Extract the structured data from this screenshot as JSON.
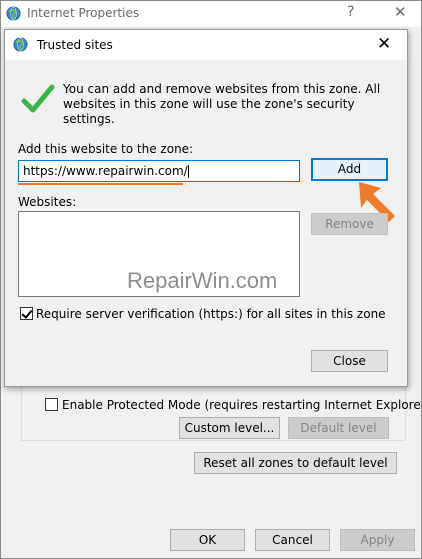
{
  "outer_window": {
    "title": "Internet Properties",
    "help_glyph": "?",
    "close_glyph": "✕",
    "enable_protected_mode_label": "Enable Protected Mode (requires restarting Internet Explorer)",
    "enable_protected_mode_checked": false,
    "custom_level_label": "Custom level...",
    "default_level_label": "Default level",
    "reset_all_label": "Reset all zones to default level",
    "ok_label": "OK",
    "cancel_label": "Cancel",
    "apply_label": "Apply"
  },
  "dialog": {
    "title": "Trusted sites",
    "close_glyph": "✕",
    "info_text": "You can add and remove websites from this zone. All websites in this zone will use the zone's security settings.",
    "add_label": "Add this website to the zone:",
    "url_value": "https://www.repairwin.com/",
    "add_button_label": "Add",
    "websites_label": "Websites:",
    "remove_button_label": "Remove",
    "require_https_label": "Require server verification (https:) for all sites in this zone",
    "require_https_checked": true,
    "close_button_label": "Close"
  },
  "watermark": "RepairWin.com",
  "colors": {
    "accent": "#0078d7",
    "annotation": "#f07c28",
    "success": "#3bb54a"
  },
  "icons": [
    "globe-icon",
    "checkmark-icon",
    "close-icon",
    "arrow-annotation-icon"
  ]
}
